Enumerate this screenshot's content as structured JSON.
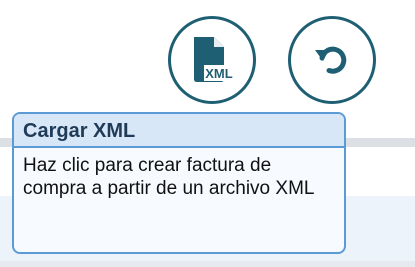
{
  "toolbar": {
    "xml_button_icon": "file-xml-icon",
    "xml_icon_text": "XML",
    "reset_button_icon": "undo-icon",
    "accent_color": "#1f5f74"
  },
  "tooltip": {
    "title": "Cargar XML",
    "body": "Haz clic para crear factura de compra a partir de un archivo XML",
    "header_bg": "#d7e7f7",
    "border_color": "#5b9bd5"
  }
}
